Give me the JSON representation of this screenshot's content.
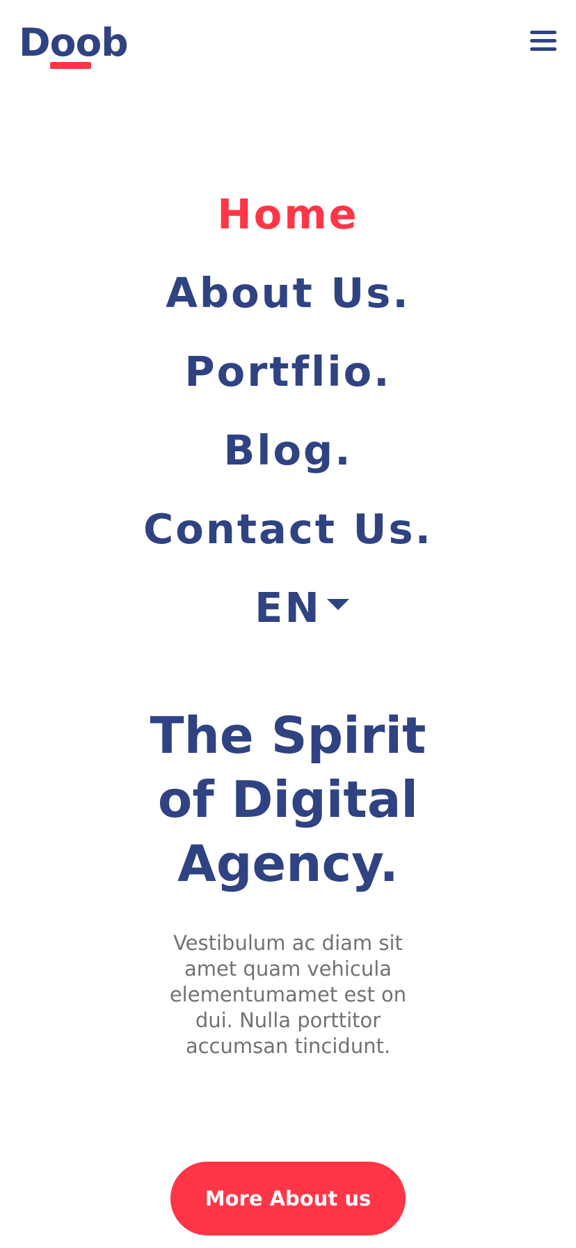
{
  "header": {
    "logo_text": "Doob",
    "menu_icon": "hamburger-menu-icon",
    "colors": {
      "brand_blue": "#2f4282",
      "accent_red": "#ff3548"
    }
  },
  "nav": {
    "items": [
      {
        "label": "Home",
        "active": true
      },
      {
        "label": "About Us.",
        "active": false
      },
      {
        "label": "Portflio.",
        "active": false
      },
      {
        "label": "Blog.",
        "active": false
      },
      {
        "label": "Contact Us.",
        "active": false
      }
    ],
    "language": {
      "selected": "EN",
      "icon": "caret-down-icon"
    }
  },
  "hero": {
    "title": "The Spirit\nof Digital\nAgency.",
    "description": "Vestibulum ac diam sit amet quam vehicula elementumamet est on dui. Nulla porttitor accumsan tincidunt.",
    "cta_label": "More About us"
  }
}
